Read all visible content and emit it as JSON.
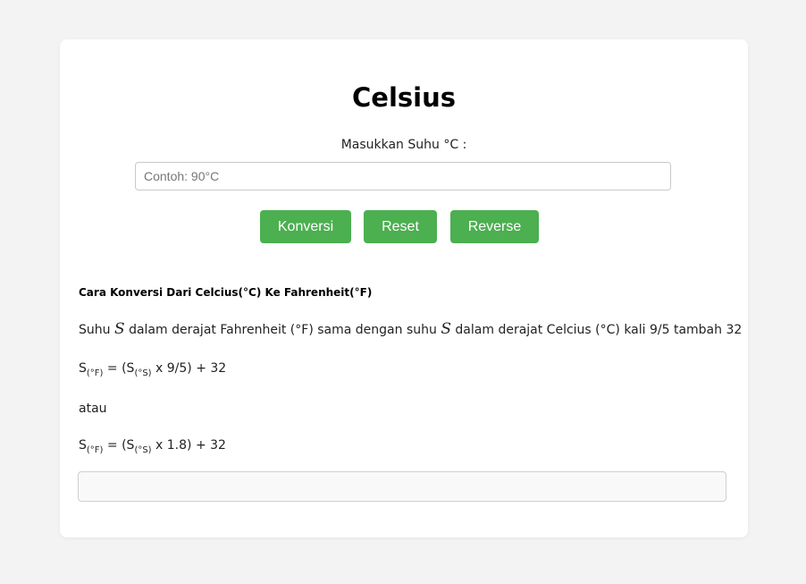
{
  "header": {
    "title": "Celsius"
  },
  "form": {
    "label": "Masukkan Suhu °C :",
    "input_placeholder": "Contoh: 90°C",
    "input_value": "",
    "buttons": {
      "convert": "Konversi",
      "reset": "Reset",
      "reverse": "Reverse"
    }
  },
  "explanation": {
    "heading": "Cara Konversi Dari Celcius(°C) Ke Fahrenheit(°F)",
    "desc_part1": "Suhu ",
    "var": "S",
    "desc_part2": " dalam derajat Fahrenheit (°F) sama dengan suhu ",
    "desc_part3": " dalam derajat Celcius (°C) kali 9/5 tambah 32",
    "formula1": {
      "s": "S",
      "sub_f": "(°F)",
      "mid": " = (S",
      "sub_c": "(°S)",
      "rest": " x 9/5) + 32"
    },
    "or_text": "atau",
    "formula2": {
      "s": "S",
      "sub_f": "(°F)",
      "mid": " = (S",
      "sub_c": "(°S)",
      "rest": " x 1.8) + 32"
    }
  },
  "result": {
    "value": ""
  },
  "colors": {
    "button_bg": "#4caf50",
    "page_bg": "#f3f3f3",
    "card_bg": "#ffffff"
  }
}
